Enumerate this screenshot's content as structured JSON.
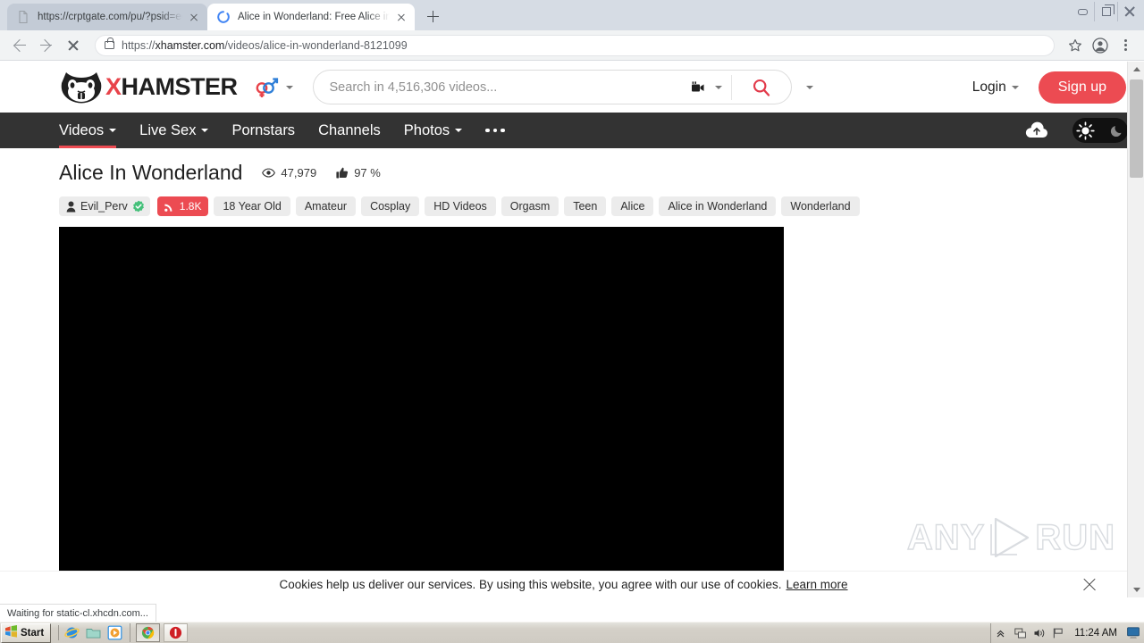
{
  "window": {
    "controls": {
      "minimize": "minimize-button",
      "maximize": "restore-button",
      "close": "close-button"
    }
  },
  "browser": {
    "tabs": [
      {
        "title": "https://crptgate.com/pu/?psid=ed_",
        "favicon": "page-icon",
        "active": false
      },
      {
        "title": "Alice in Wonderland: Free Alice in Wo",
        "favicon": "loading-spinner-icon",
        "active": true
      }
    ],
    "new_tab_label": "+",
    "toolbar": {
      "back": "back-button",
      "forward": "forward-button",
      "stop": "stop-button",
      "url_scheme": "https://",
      "url_host": "xhamster.com",
      "url_path": "/videos/alice-in-wonderland-8121099",
      "bookmark": "bookmark-star-icon",
      "profile": "profile-icon",
      "menu": "chrome-menu-icon"
    },
    "status_text": "Waiting for static-cl.xhcdn.com..."
  },
  "site": {
    "logo": {
      "brand_x": "X",
      "brand_rest": "HAMSTER"
    },
    "search": {
      "placeholder": "Search in 4,516,306 videos...",
      "value": "",
      "category_icon": "video-camera-icon",
      "submit_icon": "search-icon"
    },
    "account": {
      "login_label": "Login",
      "signup_label": "Sign up"
    },
    "nav": {
      "items": [
        {
          "label": "Videos",
          "caret": true,
          "active": true
        },
        {
          "label": "Live Sex",
          "caret": true,
          "active": false
        },
        {
          "label": "Pornstars",
          "caret": false,
          "active": false
        },
        {
          "label": "Channels",
          "caret": false,
          "active": false
        },
        {
          "label": "Photos",
          "caret": true,
          "active": false
        }
      ],
      "more_label": "more-menu",
      "upload_icon": "cloud-upload-icon",
      "theme_toggle": {
        "light_icon": "sun-icon",
        "dark_icon": "moon-icon"
      }
    },
    "video": {
      "title": "Alice In Wonderland",
      "views_icon": "eye-icon",
      "views": "47,979",
      "rating_icon": "thumbs-up-icon",
      "rating": "97 %",
      "uploader": {
        "name": "Evil_Perv",
        "person_icon": "person-icon",
        "verified_icon": "verified-badge-icon",
        "subscribers": "1.8K",
        "subscribe_icon": "rss-icon"
      },
      "tags": [
        "18 Year Old",
        "Amateur",
        "Cosplay",
        "HD Videos",
        "Orgasm",
        "Teen",
        "Alice",
        "Alice in Wonderland",
        "Wonderland"
      ]
    },
    "cookie_bar": {
      "text": "Cookies help us deliver our services. By using this website, you agree with our use of cookies.",
      "link_label": "Learn more",
      "close_icon": "close-icon"
    },
    "watermark": {
      "left": "ANY",
      "right": "RUN",
      "play_icon": "play-triangle-icon"
    }
  },
  "colors": {
    "brand_red": "#ec4b52",
    "nav_bg": "#333333",
    "tag_bg": "#ececec",
    "verified_green": "#45c07a"
  },
  "taskbar": {
    "start_label": "Start",
    "quick_launch": [
      "internet-explorer-icon",
      "folder-icon",
      "media-player-icon"
    ],
    "tasks": [
      "chrome-taskbar-button",
      "recorder-taskbar-button"
    ],
    "tray": [
      "show-hidden-icon",
      "network-icon",
      "volume-icon",
      "flag-icon"
    ],
    "clock": "11:24 AM"
  }
}
